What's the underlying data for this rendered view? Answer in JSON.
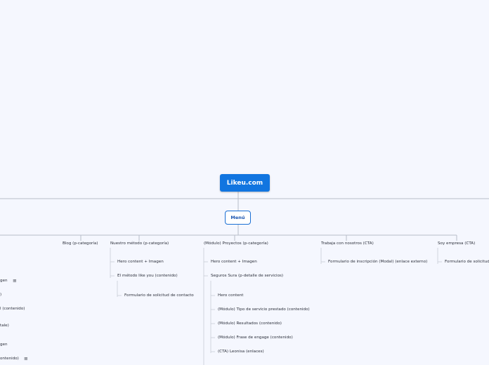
{
  "root": {
    "label": "Likeu.com"
  },
  "menu": {
    "label": "Menú"
  },
  "icons": {
    "note": "≡",
    "note_name": "notes-icon"
  },
  "branches": {
    "left_hidden": {
      "items": [
        "gen",
        ")",
        "l (contenido)",
        "tale)",
        "gen",
        "ontenido)"
      ]
    },
    "blog": {
      "label": "Blog (p-categoría)"
    },
    "metodo": {
      "label": "Nuestro método (p-categoría)",
      "children": [
        {
          "label": "Hero content + Imagen"
        },
        {
          "label": "El método like you (contenido)"
        }
      ],
      "grandchildren": [
        {
          "label": "Formulario de solicitud de contacto"
        }
      ]
    },
    "proyectos": {
      "label": "(Módulo) Proyectos (p-categoría)",
      "children": [
        {
          "label": "Hero content + Imagen"
        },
        {
          "label": "Seguros Sura (p-detalle de servicios)"
        }
      ],
      "grandchildren": [
        {
          "label": "Hero content"
        },
        {
          "label": "(Módulo) Tipo de servicio prestado (contenido)"
        },
        {
          "label": "(Módulo) Resultados (contenido)"
        },
        {
          "label": "(Módulo) Frase de engage (contenido)"
        },
        {
          "label": "(CTA) Leonisa (enlaces)"
        }
      ]
    },
    "trabaja": {
      "label": "Trabaja con nosotros (CTA)",
      "children": [
        {
          "label": "Formulario de inscripción (Modal) (enlace externo)"
        }
      ]
    },
    "soy": {
      "label": "Soy empresa (CTA)",
      "children": [
        {
          "label": "Formulario de solicitud"
        }
      ]
    }
  }
}
